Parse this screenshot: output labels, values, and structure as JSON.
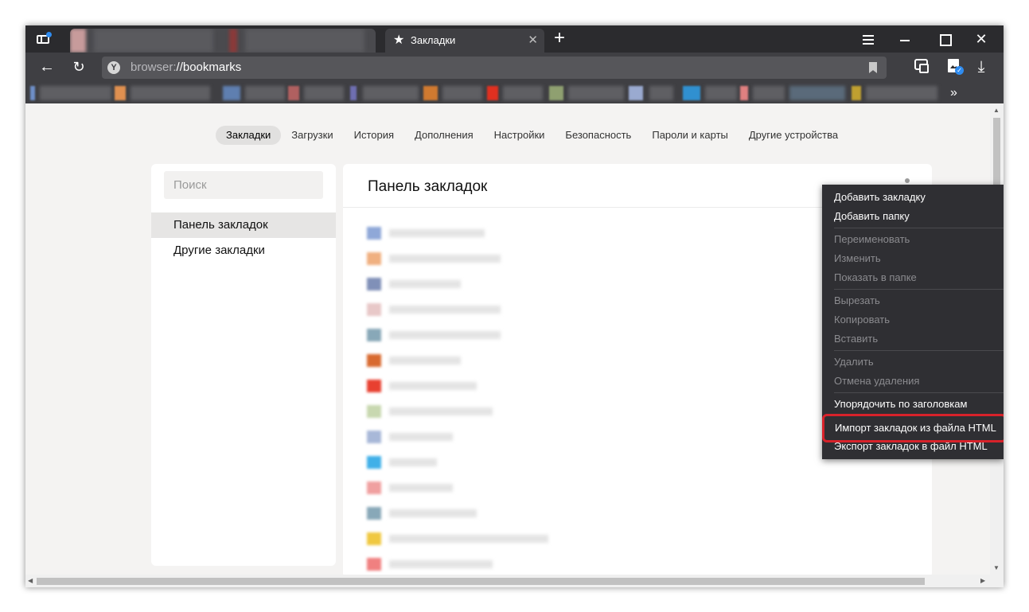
{
  "tabs": {
    "active_label": "Закладки"
  },
  "address_bar": {
    "scheme": "browser:",
    "path": "//bookmarks"
  },
  "top_nav": {
    "items": [
      "Закладки",
      "Загрузки",
      "История",
      "Дополнения",
      "Настройки",
      "Безопасность",
      "Пароли и карты",
      "Другие устройства"
    ],
    "active": "Закладки"
  },
  "sidebar": {
    "search_placeholder": "Поиск",
    "folders": [
      "Панель закладок",
      "Другие закладки"
    ],
    "selected_folder": "Панель закладок"
  },
  "main": {
    "title": "Панель закладок"
  },
  "context_menu": {
    "add_bookmark": "Добавить закладку",
    "add_folder": "Добавить папку",
    "rename": "Переименовать",
    "edit": "Изменить",
    "show_in_folder": "Показать в папке",
    "cut": "Вырезать",
    "copy": "Копировать",
    "paste": "Вставить",
    "delete": "Удалить",
    "undo_delete": "Отмена удаления",
    "sort_by_title": "Упорядочить по заголовкам",
    "import_html": "Импорт закладок из файла HTML",
    "export_html": "Экспорт закладок в файл HTML"
  },
  "colors": {
    "highlight_border": "#d7222a",
    "menu_bg": "#2f2f33",
    "accent": "#2f8cf0"
  },
  "icons": {
    "sidebar_toggle": "sidebar-toggle-icon",
    "tab_star": "star-icon",
    "back": "arrow-left-icon",
    "reload": "reload-icon",
    "download": "download-icon"
  }
}
